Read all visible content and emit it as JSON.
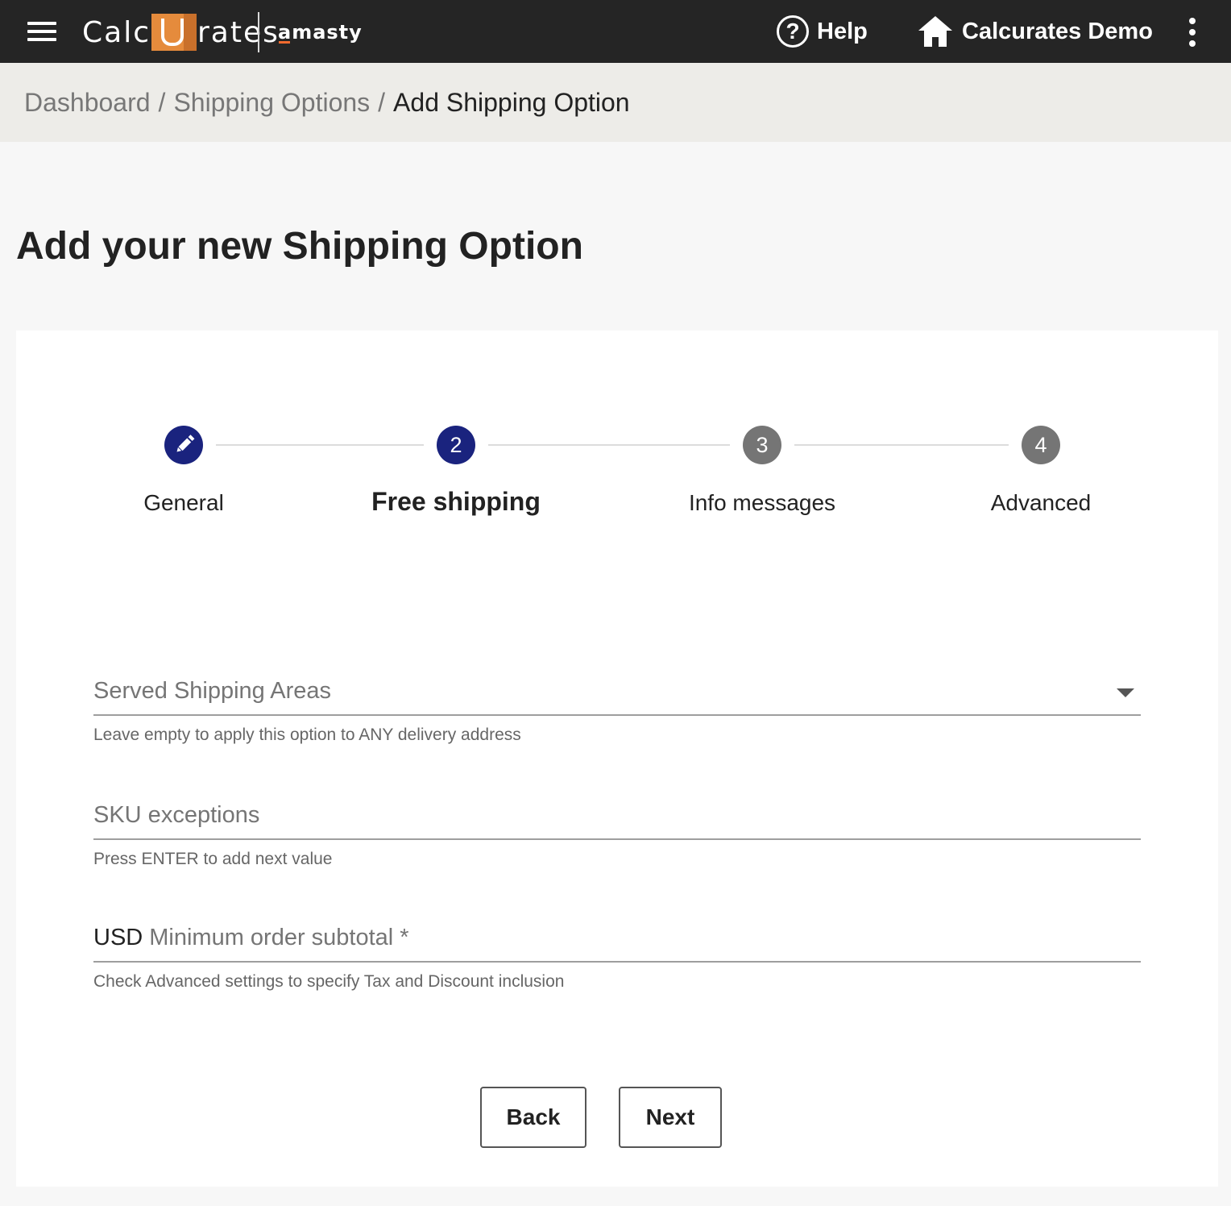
{
  "header": {
    "logo_left": "Calc",
    "logo_right": "rates",
    "partner_brand": "amasty",
    "help_label": "Help",
    "store_label": "Calcurates Demo"
  },
  "breadcrumb": {
    "items": [
      "Dashboard",
      "Shipping Options"
    ],
    "separator": "/",
    "current": "Add Shipping Option"
  },
  "page": {
    "title": "Add your new Shipping Option"
  },
  "stepper": {
    "steps": [
      {
        "number": "",
        "label": "General",
        "state": "completed"
      },
      {
        "number": "2",
        "label": "Free shipping",
        "state": "active"
      },
      {
        "number": "3",
        "label": "Info messages",
        "state": "pending"
      },
      {
        "number": "4",
        "label": "Advanced",
        "state": "pending"
      }
    ],
    "active_color": "#1a237e",
    "pending_color": "#757575"
  },
  "form": {
    "shipping_areas": {
      "placeholder": "Served Shipping Areas",
      "hint": "Leave empty to apply this option to ANY delivery address"
    },
    "sku_exceptions": {
      "placeholder": "SKU exceptions",
      "hint": "Press ENTER to add next value"
    },
    "min_subtotal": {
      "currency": "USD",
      "placeholder": "Minimum order subtotal *",
      "hint": "Check Advanced settings to specify Tax and Discount inclusion"
    }
  },
  "actions": {
    "back_label": "Back",
    "next_label": "Next"
  },
  "icons": {
    "menu": "hamburger-menu-icon",
    "help": "help-circle-icon",
    "store": "home-icon",
    "more": "more-vert-icon",
    "step_done": "pencil-icon",
    "select": "dropdown-arrow-icon"
  },
  "colors": {
    "topbar": "#252525",
    "breadcrumb_bg": "#edece8",
    "logo_accent": "#e58b3c",
    "brand_accent": "#f26a2e"
  }
}
